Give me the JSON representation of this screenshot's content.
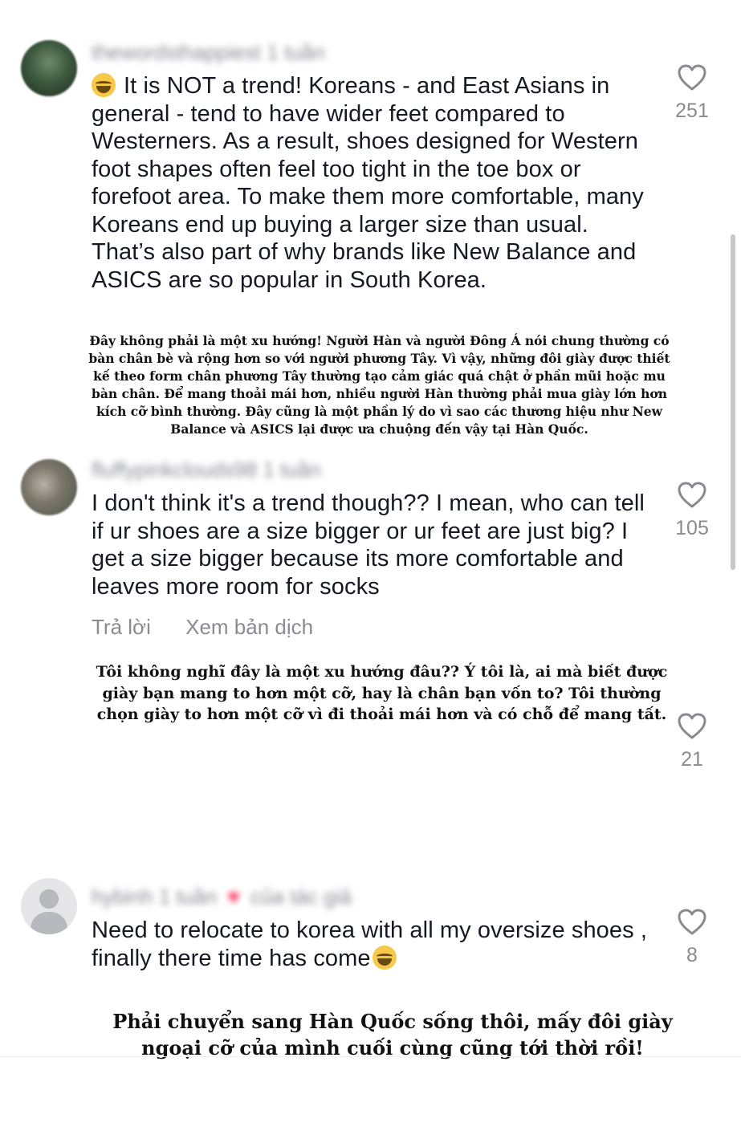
{
  "comments": [
    {
      "username": "thewordsthappiest",
      "time": "1 tuần",
      "text": "It is NOT a trend! Koreans - and East Asians in general - tend to have wider feet compared to Westerners. As a result, shoes designed for Western foot shapes often feel too tight in the toe box or forefoot area. To make them more comfortable, many Koreans end up buying a larger size than usual. That’s also part of why brands like New Balance and ASICS are so popular in South Korea.",
      "likes": "251",
      "translation": "Đây không phải là một xu hướng! Người Hàn và người Đông Á nói chung thường có bàn chân bè và rộng hơn so với người phương Tây. Vì vậy, những đôi giày được thiết kế theo form chân phương Tây thường tạo cảm giác quá chật ở phần mũi hoặc mu bàn chân. Để mang thoải mái hơn, nhiều người Hàn thường phải mua giày lớn hơn kích cỡ bình thường. Đây cũng là một phần lý do vì sao các thương hiệu như New Balance và ASICS lại được ưa chuộng đến vậy tại Hàn Quốc."
    },
    {
      "username": "fluffypinkclouds98",
      "time": "1 tuần",
      "text": "I don't think it's a trend though?? I mean, who can tell if ur shoes are a size bigger or ur feet are just big? I get a size bigger because its more comfortable and leaves more room for socks",
      "likes": "105",
      "reply_label": "Trả lời",
      "translate_label": "Xem bản dịch",
      "translation": "Tôi không nghĩ đây là một xu hướng đâu?? Ý tôi là, ai mà biết được giày bạn mang to hơn một cỡ, hay là chân bạn vốn to? Tôi thường chọn giày to hơn một cỡ vì đi thoải mái hơn và có chỗ để mang tất.",
      "translation_likes": "21"
    },
    {
      "username": "hybinh",
      "time": "1 tuần",
      "author_liked": "của tác giả",
      "text": "Need to relocate to korea with all my oversize shoes , finally there time has come",
      "likes": "8",
      "translation": "Phải chuyển sang Hàn Quốc sống thôi, mấy đôi giày ngoại cỡ của mình cuối cùng cũng tới thời rồi!"
    }
  ],
  "icons": {
    "emoji": "laughing-crying-emoji",
    "like": "heart-outline-icon",
    "avatar_default": "default-avatar-icon"
  },
  "colors": {
    "text": "#161823",
    "secondary": "#8a8b91",
    "like_heart": "#fe2c55"
  }
}
